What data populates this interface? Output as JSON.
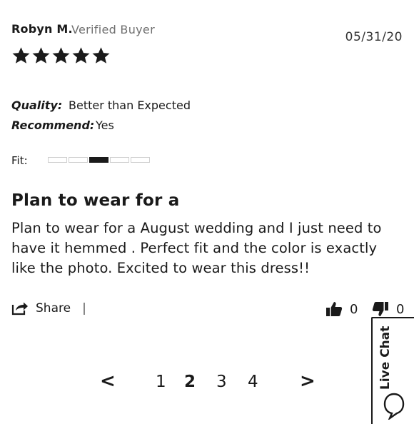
{
  "review": {
    "reviewer": "Robyn M.",
    "badge": "Verified Buyer",
    "date": "05/31/20",
    "rating": 5,
    "quality_label": "Quality:",
    "quality_value": "Better than Expected",
    "recommend_label": "Recommend:",
    "recommend_value": "Yes",
    "fit_label": "Fit:",
    "fit_level": 3,
    "fit_segments": 5,
    "title": "Plan to wear for a",
    "body": "Plan to wear for a August wedding and I just need to have it hemmed . Perfect fit and the color is exactly like the photo. Excited to wear this dress!!"
  },
  "actions": {
    "share_label": "Share",
    "separator": "|",
    "helpful_count": "0",
    "unhelpful_count": "0"
  },
  "pagination": {
    "prev": "<",
    "pages": [
      "1",
      "2",
      "3",
      "4"
    ],
    "current": "2",
    "next": ">"
  },
  "live_chat": {
    "label": "Live Chat"
  },
  "icons": {
    "star": "star-icon",
    "share": "share-icon",
    "thumbs_up": "thumbs-up-icon",
    "thumbs_down": "thumbs-down-icon",
    "chat": "chat-bubble-icon"
  },
  "colors": {
    "text": "#1a1a1a",
    "muted": "#6f6f6f",
    "fit_inactive_border": "#cfcfcf"
  }
}
